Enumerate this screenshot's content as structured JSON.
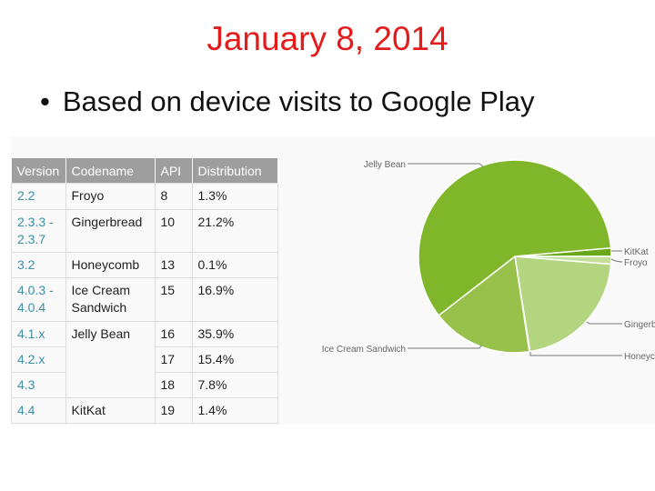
{
  "title": "January 8, 2014",
  "bullet": "Based on device visits to Google Play",
  "table": {
    "headers": [
      "Version",
      "Codename",
      "API",
      "Distribution"
    ],
    "rows": [
      {
        "version": "2.2",
        "codename": "Froyo",
        "api": "8",
        "dist": "1.3%"
      },
      {
        "version": "2.3.3 - 2.3.7",
        "codename": "Gingerbread",
        "api": "10",
        "dist": "21.2%"
      },
      {
        "version": "3.2",
        "codename": "Honeycomb",
        "api": "13",
        "dist": "0.1%"
      },
      {
        "version": "4.0.3 - 4.0.4",
        "codename": "Ice Cream Sandwich",
        "api": "15",
        "dist": "16.9%"
      },
      {
        "version": "4.1.x",
        "codename": "Jelly Bean",
        "api": "16",
        "dist": "35.9%"
      },
      {
        "version": "4.2.x",
        "api": "17",
        "dist": "15.4%"
      },
      {
        "version": "4.3",
        "api": "18",
        "dist": "7.8%"
      },
      {
        "version": "4.4",
        "codename": "KitKat",
        "api": "19",
        "dist": "1.4%"
      }
    ]
  },
  "chart_data": {
    "type": "pie",
    "categories": [
      "KitKat",
      "Froyo",
      "Gingerbread",
      "Honeycomb",
      "Ice Cream Sandwich",
      "Jelly Bean"
    ],
    "values": [
      1.4,
      1.3,
      21.2,
      0.1,
      16.9,
      59.1
    ],
    "colors": [
      "#6aa81a",
      "#c2de9a",
      "#b3d57f",
      "#a8cf6a",
      "#97c14a",
      "#80b72a"
    ],
    "legend": "none"
  }
}
